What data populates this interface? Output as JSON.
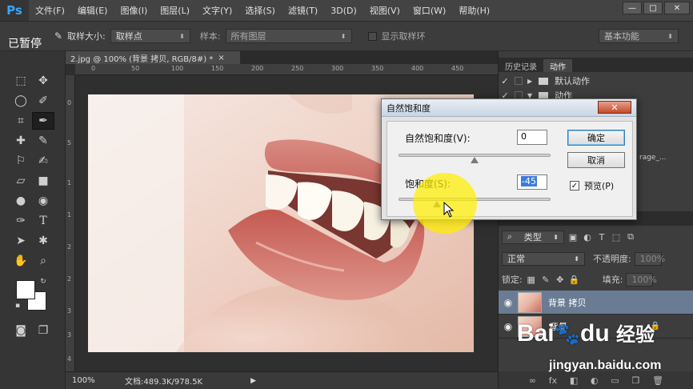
{
  "app": {
    "logo": "Ps"
  },
  "menu": [
    "文件(F)",
    "编辑(E)",
    "图像(I)",
    "图层(L)",
    "文字(Y)",
    "选择(S)",
    "滤镜(T)",
    "3D(D)",
    "视图(V)",
    "窗口(W)",
    "帮助(H)"
  ],
  "window_controls": {
    "minimize": "—",
    "maximize": "□",
    "close": "✕"
  },
  "overlay_status": "已暂停",
  "options": {
    "sample_size_label": "取样大小:",
    "sample_size_value": "取样点",
    "sample_label": "样本:",
    "sample_value": "所有图层",
    "show_ring_label": "显示取样环",
    "workspace": "基本功能"
  },
  "document": {
    "tab_title": "2.jpg @ 100% (背景 拷贝, RGB/8#) *",
    "tab_close": "×",
    "ruler_h": [
      "0",
      "50",
      "100",
      "150",
      "200",
      "250",
      "300",
      "350",
      "400",
      "450"
    ],
    "ruler_v": [
      "0",
      "5",
      "1",
      "1",
      "2",
      "2",
      "3",
      "3",
      "4"
    ],
    "zoom": "100%",
    "doc_info": "文档:489.3K/978.5K",
    "status_arrow": "▶"
  },
  "history_panel": {
    "tabs": [
      "历史记录",
      "动作"
    ],
    "actions": [
      {
        "name": "默认动作",
        "checked": "✓"
      },
      {
        "name": "动作",
        "checked": "✓"
      }
    ],
    "partial_text": "rage_..."
  },
  "layers_panel": {
    "filter": "类型",
    "blend_mode": "正常",
    "opacity_label": "不透明度:",
    "opacity_value": "100%",
    "lock_label": "锁定:",
    "fill_label": "填充:",
    "fill_value": "100%",
    "layers": [
      {
        "name": "背景 拷贝",
        "selected": true
      },
      {
        "name": "背景",
        "selected": false,
        "locked": true
      }
    ],
    "bottom_icons": [
      "link-icon",
      "fx-icon",
      "mask-icon",
      "adjustment-icon",
      "folder-icon",
      "new-layer-icon",
      "trash-icon"
    ]
  },
  "dialog": {
    "title": "自然饱和度",
    "close": "✕",
    "vibrance_label": "自然饱和度(V):",
    "vibrance_value": "0",
    "saturation_label": "饱和度(S):",
    "saturation_value": "-45",
    "ok": "确定",
    "cancel": "取消",
    "preview_label": "预览(P)",
    "preview_checked": "✓"
  },
  "watermark": {
    "brand": "Bai",
    "brand2": "du",
    "cn": "经验",
    "url": "jingyan.baidu.com"
  },
  "colors": {
    "accent": "#39a5ff",
    "selected_layer": "#6a7c93",
    "highlight": "#ffee00"
  }
}
